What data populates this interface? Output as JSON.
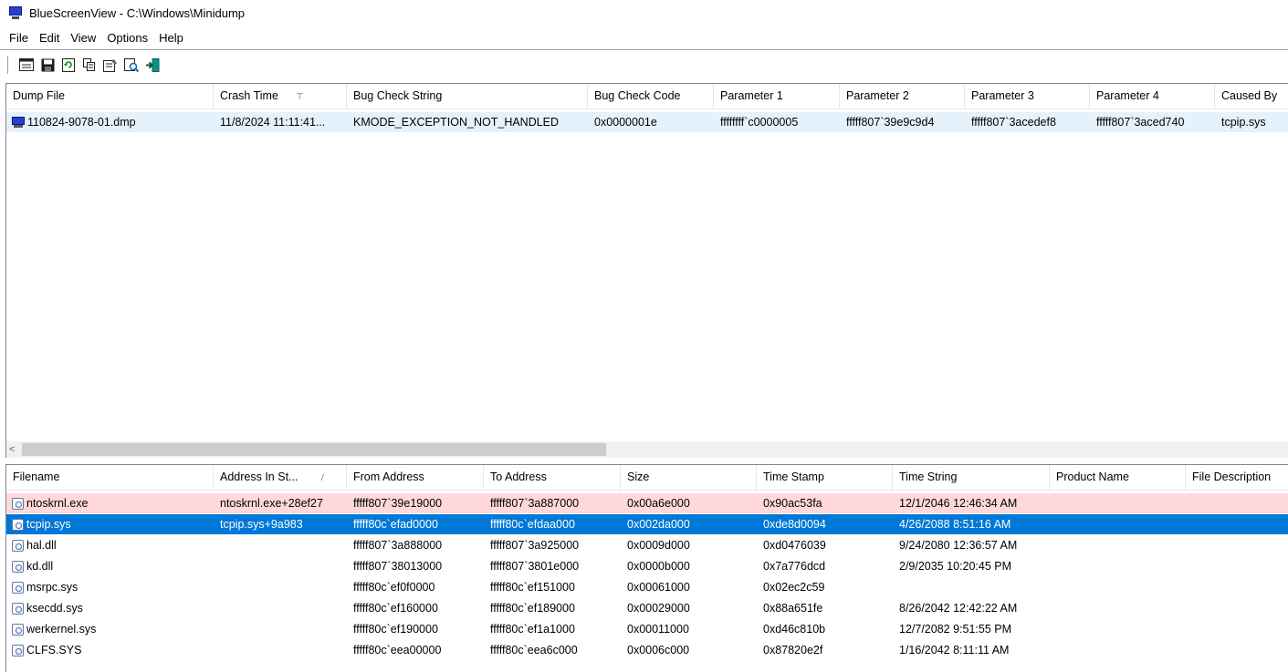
{
  "window": {
    "title": "BlueScreenView  -  C:\\Windows\\Minidump",
    "app_icon": "bluescreen-app-icon"
  },
  "menu": [
    "File",
    "Edit",
    "View",
    "Options",
    "Help"
  ],
  "toolbar": {
    "buttons": [
      {
        "name": "html-report-icon"
      },
      {
        "name": "save-icon"
      },
      {
        "name": "refresh-icon"
      },
      {
        "name": "copy-icon"
      },
      {
        "name": "properties-icon"
      },
      {
        "name": "find-icon"
      },
      {
        "name": "exit-icon"
      }
    ]
  },
  "dumps": {
    "columns": [
      "Dump File",
      "Crash Time",
      "Bug Check String",
      "Bug Check Code",
      "Parameter 1",
      "Parameter 2",
      "Parameter 3",
      "Parameter 4",
      "Caused By"
    ],
    "sort_indicator": "⊤",
    "rows": [
      [
        "110824-9078-01.dmp",
        "11/8/2024 11:11:41...",
        "KMODE_EXCEPTION_NOT_HANDLED",
        "0x0000001e",
        "ffffffff`c0000005",
        "fffff807`39e9c9d4",
        "fffff807`3acedef8",
        "fffff807`3aced740",
        "tcpip.sys"
      ]
    ]
  },
  "scroll": {
    "left_arrow": "<"
  },
  "modules": {
    "columns": [
      "Filename",
      "Address In St...",
      "From Address",
      "To Address",
      "Size",
      "Time Stamp",
      "Time String",
      "Product Name",
      "File Description"
    ],
    "sort_indicator": "/",
    "rows": [
      [
        "ntoskrnl.exe",
        "ntoskrnl.exe+28ef27",
        "fffff807`39e19000",
        "fffff807`3a887000",
        "0x00a6e000",
        "0x90ac53fa",
        "12/1/2046 12:46:34 AM",
        "",
        ""
      ],
      [
        "tcpip.sys",
        "tcpip.sys+9a983",
        "fffff80c`efad0000",
        "fffff80c`efdaa000",
        "0x002da000",
        "0xde8d0094",
        "4/26/2088 8:51:16 AM",
        "",
        ""
      ],
      [
        "hal.dll",
        "",
        "fffff807`3a888000",
        "fffff807`3a925000",
        "0x0009d000",
        "0xd0476039",
        "9/24/2080 12:36:57 AM",
        "",
        ""
      ],
      [
        "kd.dll",
        "",
        "fffff807`38013000",
        "fffff807`3801e000",
        "0x0000b000",
        "0x7a776dcd",
        "2/9/2035 10:20:45 PM",
        "",
        ""
      ],
      [
        "msrpc.sys",
        "",
        "fffff80c`ef0f0000",
        "fffff80c`ef151000",
        "0x00061000",
        "0x02ec2c59",
        "",
        "",
        ""
      ],
      [
        "ksecdd.sys",
        "",
        "fffff80c`ef160000",
        "fffff80c`ef189000",
        "0x00029000",
        "0x88a651fe",
        "8/26/2042 12:42:22 AM",
        "",
        ""
      ],
      [
        "werkernel.sys",
        "",
        "fffff80c`ef190000",
        "fffff80c`ef1a1000",
        "0x00011000",
        "0xd46c810b",
        "12/7/2082 9:51:55 PM",
        "",
        ""
      ],
      [
        "CLFS.SYS",
        "",
        "fffff80c`eea00000",
        "fffff80c`eea6c000",
        "0x0006c000",
        "0x87820e2f",
        "1/16/2042 8:11:11 AM",
        "",
        ""
      ]
    ]
  },
  "colors": {
    "selected": "#0078d7",
    "highlight": "#ffd9d9",
    "scroll_track": "#f0f0f0",
    "scroll_thumb": "#cdcdcd"
  }
}
